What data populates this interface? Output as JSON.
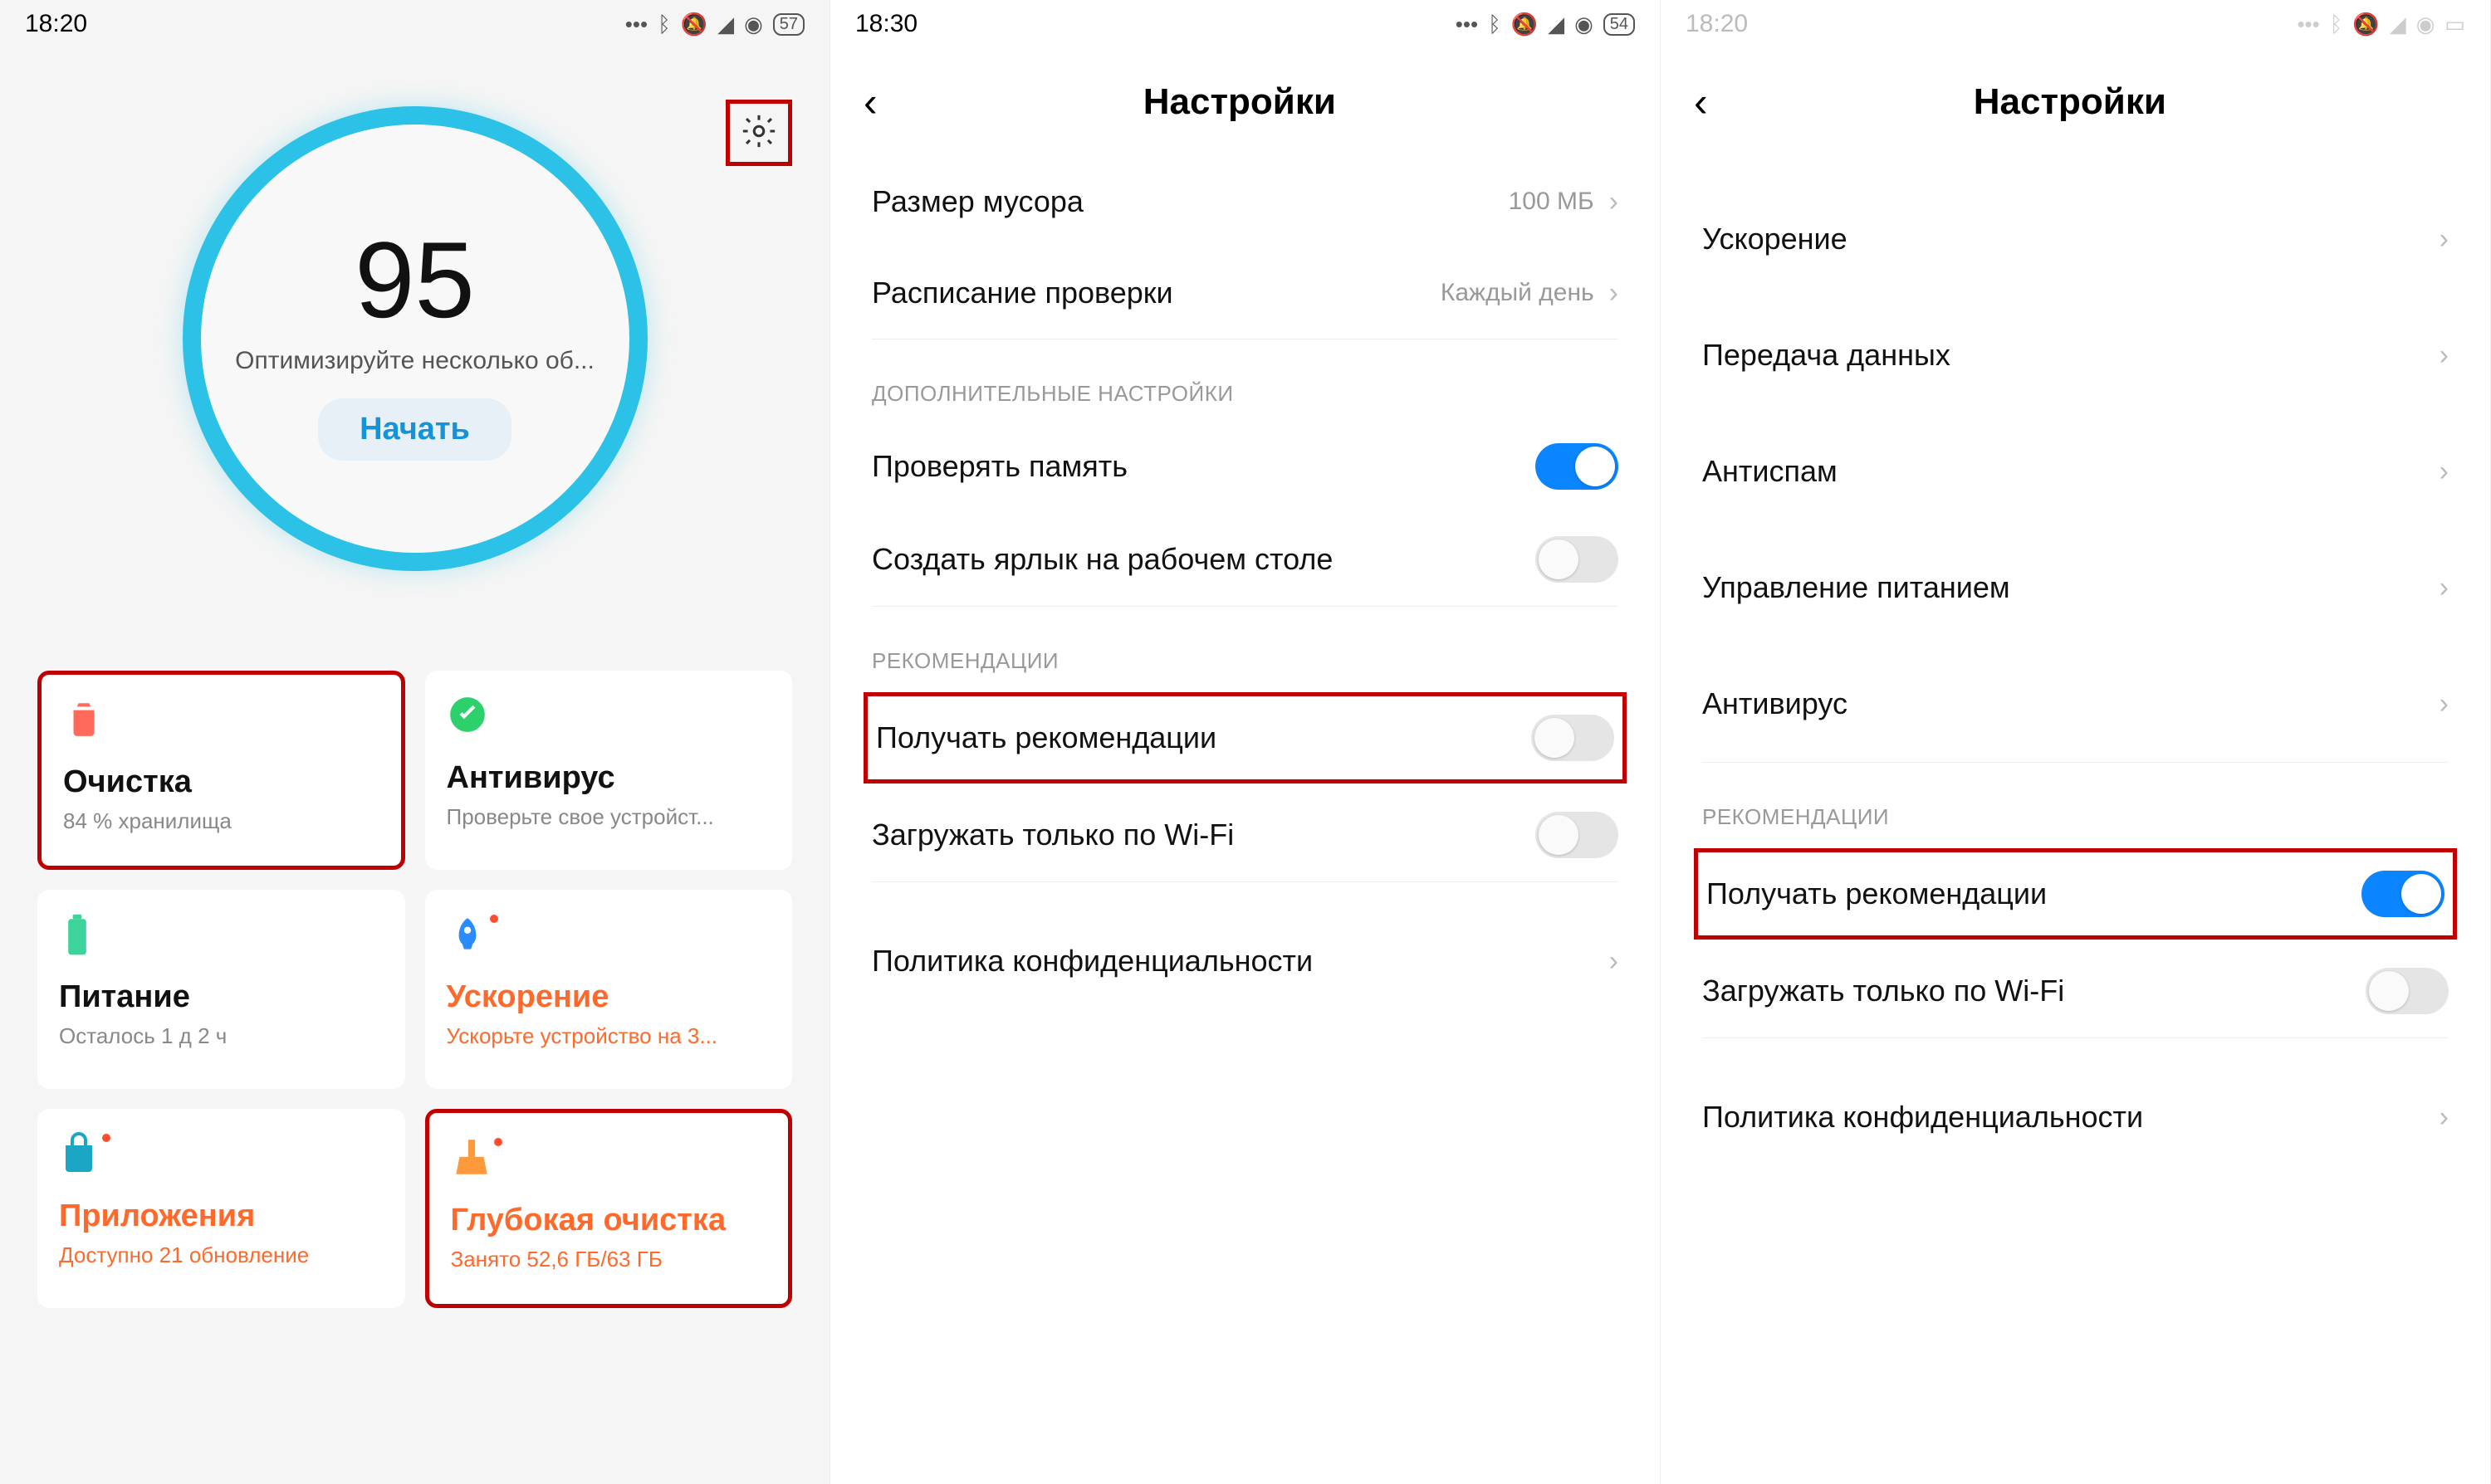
{
  "phone1": {
    "status": {
      "time": "18:20",
      "battery": "57"
    },
    "score": "95",
    "optimize": "Оптимизируйте несколько об...",
    "start": "Начать",
    "tiles": [
      {
        "title": "Очистка",
        "sub": "84 % хранилища",
        "orange": false,
        "highlight": true,
        "dot": false,
        "icon": "trash",
        "iconColor": "#ff6a5a"
      },
      {
        "title": "Антивирус",
        "sub": "Проверьте свое устройст...",
        "orange": false,
        "highlight": false,
        "dot": false,
        "icon": "check",
        "iconColor": "#2dd16c"
      },
      {
        "title": "Питание",
        "sub": "Осталось 1 д 2 ч",
        "orange": false,
        "highlight": false,
        "dot": false,
        "icon": "battery",
        "iconColor": "#3cd49a"
      },
      {
        "title": "Ускорение",
        "sub": "Ускорьте устройство на 3...",
        "orange": true,
        "highlight": false,
        "dot": true,
        "icon": "rocket",
        "iconColor": "#2a8cff"
      },
      {
        "title": "Приложения",
        "sub": "Доступно 21 обновление",
        "orange": true,
        "highlight": false,
        "dot": true,
        "icon": "apps",
        "iconColor": "#1aa7c6"
      },
      {
        "title": "Глубокая очистка",
        "sub": "Занято 52,6 ГБ/63 ГБ",
        "orange": true,
        "highlight": true,
        "dot": true,
        "icon": "broom",
        "iconColor": "#ff9a3c"
      }
    ]
  },
  "phone2": {
    "status": {
      "time": "18:30",
      "battery": "54"
    },
    "title": "Настройки",
    "trash_size_label": "Размер мусора",
    "trash_size_value": "100 МБ",
    "schedule_label": "Расписание проверки",
    "schedule_value": "Каждый день",
    "section_extra": "ДОПОЛНИТЕЛЬНЫЕ НАСТРОЙКИ",
    "check_memory": "Проверять память",
    "shortcut": "Создать ярлык на рабочем столе",
    "section_rec": "РЕКОМЕНДАЦИИ",
    "receive_rec": "Получать рекомендации",
    "wifi_only": "Загружать только по Wi-Fi",
    "privacy": "Политика конфиденциальности"
  },
  "phone3": {
    "status": {
      "time": "18:20",
      "battery": ""
    },
    "title": "Настройки",
    "items": [
      "Ускорение",
      "Передача данных",
      "Антиспам",
      "Управление питанием",
      "Антивирус"
    ],
    "section_rec": "РЕКОМЕНДАЦИИ",
    "receive_rec": "Получать рекомендации",
    "wifi_only": "Загружать только по Wi-Fi",
    "privacy": "Политика конфиденциальности"
  }
}
